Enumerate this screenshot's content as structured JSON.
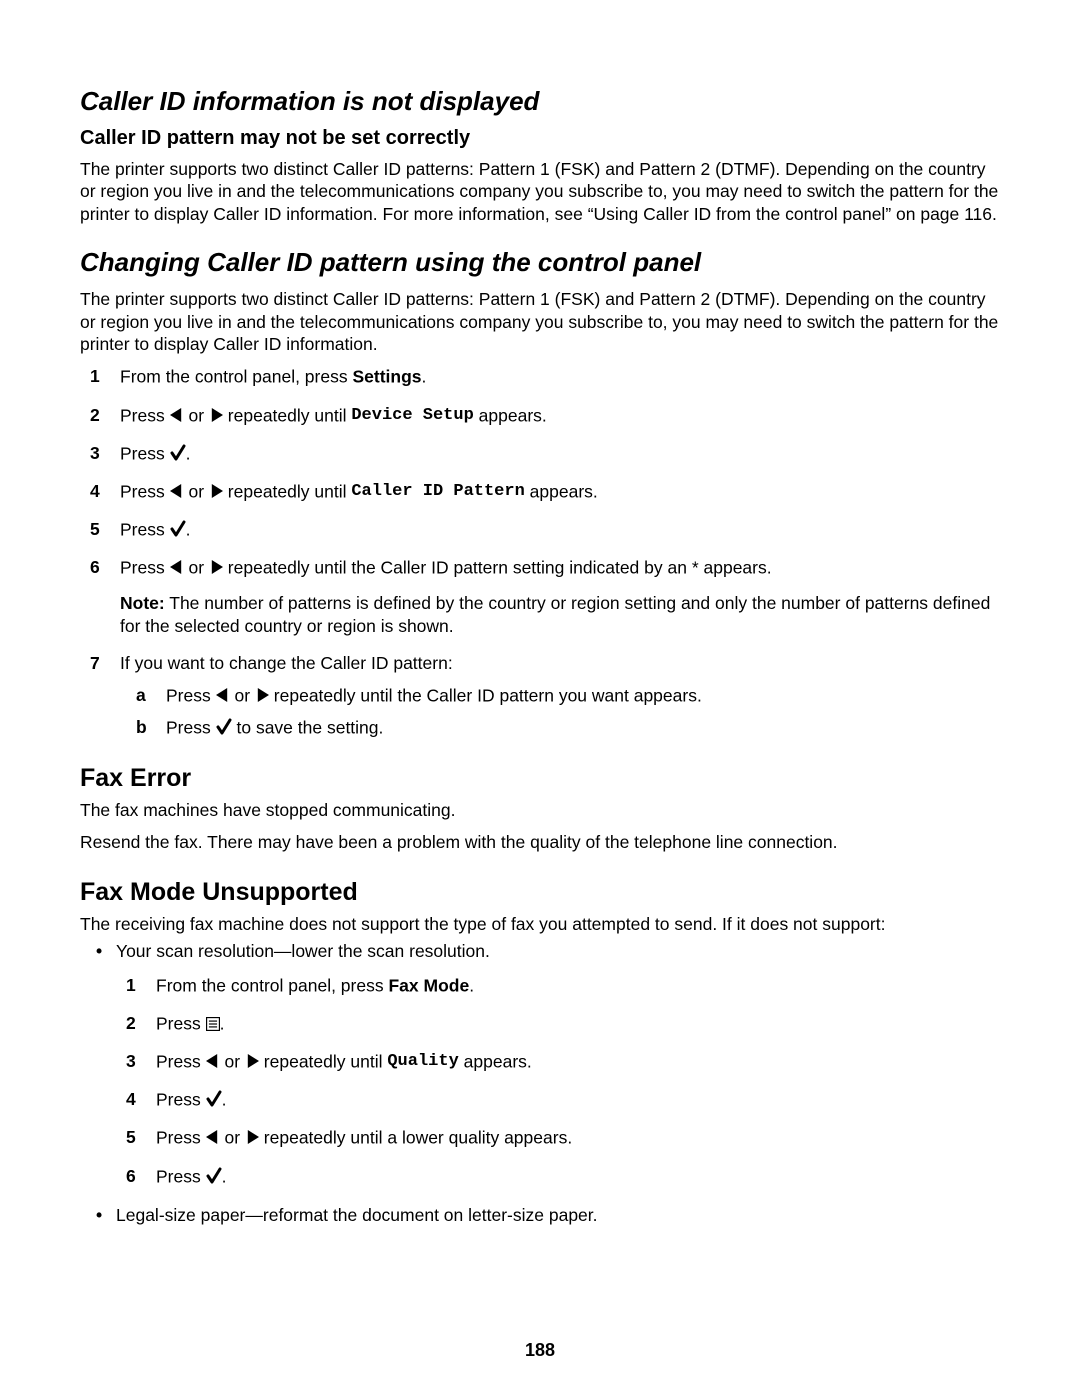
{
  "section1": {
    "title": "Caller ID information is not displayed",
    "sub1": {
      "title": "Caller ID pattern may not be set correctly",
      "p1": "The printer supports two distinct Caller ID patterns: Pattern 1 (FSK) and Pattern 2 (DTMF). Depending on the country or region you live in and the telecommunications company you subscribe to, you may need to switch the pattern for the printer to display Caller ID information. For more information, see “Using Caller ID from the control panel” on page 116."
    }
  },
  "section2": {
    "title": "Changing Caller ID pattern using the control panel",
    "p1": "The printer supports two distinct Caller ID patterns: Pattern 1 (FSK) and Pattern 2 (DTMF). Depending on the country or region you live in and the telecommunications company you subscribe to, you may need to switch the pattern for the printer to display Caller ID information.",
    "steps": {
      "s1_pre": "From the control panel, press ",
      "s1_bold": "Settings",
      "s1_post": ".",
      "s2_pre": "Press ",
      "s2_mid": " or ",
      "s2_mid2": " repeatedly until ",
      "s2_mono": "Device Setup",
      "s2_post": " appears.",
      "s3_pre": "Press ",
      "s3_post": ".",
      "s4_pre": "Press ",
      "s4_mid": " or ",
      "s4_mid2": " repeatedly until ",
      "s4_mono": "Caller ID Pattern",
      "s4_post": " appears.",
      "s5_pre": "Press ",
      "s5_post": ".",
      "s6_pre": "Press ",
      "s6_mid": " or ",
      "s6_post": " repeatedly until the Caller ID pattern setting indicated by an * appears.",
      "s6_note_bold": "Note:",
      "s6_note": " The number of patterns is defined by the country or region setting and only the number of patterns defined for the selected country or region is shown.",
      "s7_intro": "If you want to change the Caller ID pattern:",
      "s7a_pre": "Press ",
      "s7a_mid": " or ",
      "s7a_post": " repeatedly until the Caller ID pattern you want appears.",
      "s7b_pre": "Press ",
      "s7b_post": " to save the setting."
    }
  },
  "section3": {
    "title": "Fax Error",
    "p1": "The fax machines have stopped communicating.",
    "p2": "Resend the fax. There may have been a problem with the quality of the telephone line connection."
  },
  "section4": {
    "title": "Fax Mode Unsupported",
    "p1": "The receiving fax machine does not support the type of fax you attempted to send. If it does not support:",
    "bullet1": "Your scan resolution—lower the scan resolution.",
    "bullet2": "Legal-size paper—reformat the document on letter-size paper.",
    "inner_steps": {
      "s1_pre": "From the control panel, press ",
      "s1_bold": "Fax Mode",
      "s1_post": ".",
      "s2_pre": "Press ",
      "s2_post": ".",
      "s3_pre": "Press ",
      "s3_mid": " or ",
      "s3_mid2": " repeatedly until ",
      "s3_mono": "Quality",
      "s3_post": " appears.",
      "s4_pre": "Press ",
      "s4_post": ".",
      "s5_pre": "Press ",
      "s5_mid": " or ",
      "s5_post": " repeatedly until a lower quality appears.",
      "s6_pre": "Press ",
      "s6_post": "."
    }
  },
  "page_number": "188"
}
